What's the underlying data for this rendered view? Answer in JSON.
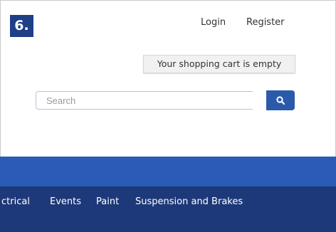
{
  "badge": {
    "label": "6."
  },
  "header": {
    "login_label": "Login",
    "register_label": "Register",
    "cart_label": "Your shopping cart is empty"
  },
  "search": {
    "placeholder": "Search",
    "value": "",
    "button_icon": "search-icon"
  },
  "nav": {
    "items": [
      {
        "label": "ctrical"
      },
      {
        "label": "Events"
      },
      {
        "label": "Paint"
      },
      {
        "label": "Suspension and Brakes"
      }
    ]
  },
  "colors": {
    "badge_bg": "#1f3f86",
    "search_button": "#2b5aab",
    "blue_band": "#2a5bb7",
    "nav_bg": "#1e3979"
  }
}
